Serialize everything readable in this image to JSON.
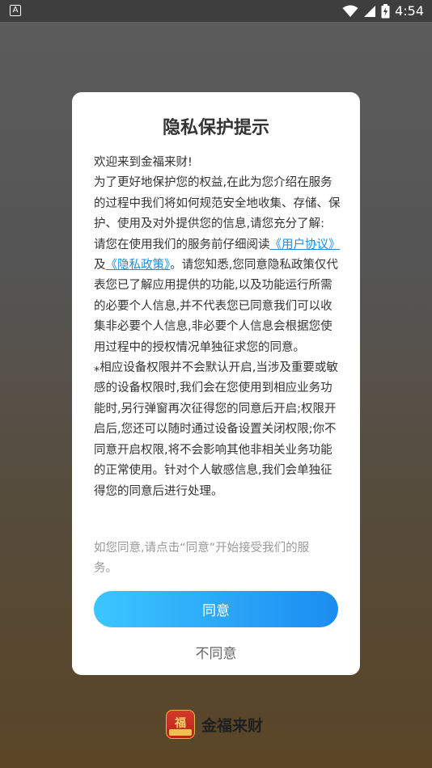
{
  "status_bar": {
    "time": "4:54",
    "app_badge": "A",
    "icons": [
      "wifi-icon",
      "signal-icon",
      "battery-icon"
    ]
  },
  "dialog": {
    "title": "隐私保护提示",
    "paragraphs": {
      "p1": "欢迎来到金福来财!",
      "p2": "为了更好地保护您的权益,在此为您介绍在服务的过程中我们将如何规范安全地收集、存储、保护、使用及对外提供您的信息,请您充分了解:",
      "p3_prefix": "请您在使用我们的服务前仔细阅读",
      "user_agreement_link": "《用户协议》",
      "p3_and": "及",
      "privacy_policy_link": "《隐私政策》",
      "p3_rest": "。请您知悉,您同意隐私政策仅代表您已了解应用提供的功能,以及功能运行所需的必要个人信息,并不代表您已同意我们可以收集非必要个人信息,非必要个人信息会根据您使用过程中的授权情况单独征求您的同意。",
      "p4": "⁎相应设备权限并不会默认开启,当涉及重要或敏感的设备权限时,我们会在您使用到相应业务功能时,另行弹窗再次征得您的同意后开启;权限开启后,您还可以随时通过设备设置关闭权限;你不同意开启权限,将不会影响其他非相关业务功能的正常使用。针对个人敏感信息,我们会单独征得您的同意后进行处理。"
    },
    "hint": "如您同意,请点击“同意”开始接受我们的服务。",
    "agree_label": "同意",
    "disagree_label": "不同意"
  },
  "brand": {
    "name": "金福来财",
    "logo_mark": "福",
    "logo_band": "金福来财"
  },
  "colors": {
    "accent_start": "#3cc6ff",
    "accent_end": "#1b8cf0",
    "link": "#1a8de6"
  }
}
